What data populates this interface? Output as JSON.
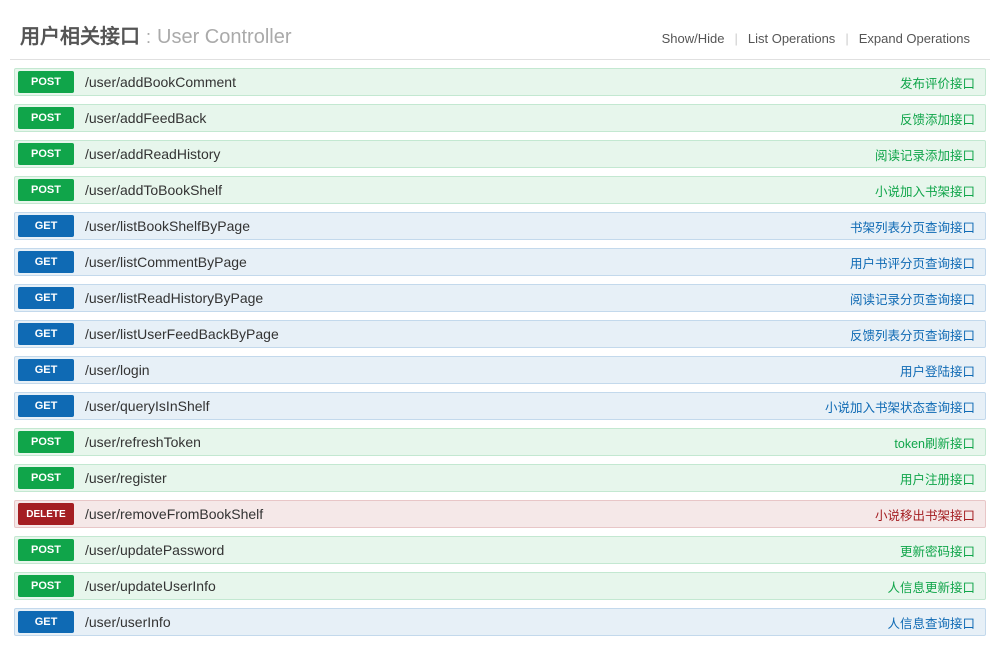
{
  "header": {
    "title_cn": "用户相关接口",
    "title_sep": ":",
    "title_en": "User Controller",
    "ops": {
      "showhide": "Show/Hide",
      "list": "List Operations",
      "expand": "Expand Operations"
    }
  },
  "endpoints": [
    {
      "method": "POST",
      "path": "/user/addBookComment",
      "desc": "发布评价接口"
    },
    {
      "method": "POST",
      "path": "/user/addFeedBack",
      "desc": "反馈添加接口"
    },
    {
      "method": "POST",
      "path": "/user/addReadHistory",
      "desc": "阅读记录添加接口"
    },
    {
      "method": "POST",
      "path": "/user/addToBookShelf",
      "desc": "小说加入书架接口"
    },
    {
      "method": "GET",
      "path": "/user/listBookShelfByPage",
      "desc": "书架列表分页查询接口"
    },
    {
      "method": "GET",
      "path": "/user/listCommentByPage",
      "desc": "用户书评分页查询接口"
    },
    {
      "method": "GET",
      "path": "/user/listReadHistoryByPage",
      "desc": "阅读记录分页查询接口"
    },
    {
      "method": "GET",
      "path": "/user/listUserFeedBackByPage",
      "desc": "反馈列表分页查询接口"
    },
    {
      "method": "GET",
      "path": "/user/login",
      "desc": "用户登陆接口"
    },
    {
      "method": "GET",
      "path": "/user/queryIsInShelf",
      "desc": "小说加入书架状态查询接口"
    },
    {
      "method": "POST",
      "path": "/user/refreshToken",
      "desc": "token刷新接口"
    },
    {
      "method": "POST",
      "path": "/user/register",
      "desc": "用户注册接口"
    },
    {
      "method": "DELETE",
      "path": "/user/removeFromBookShelf",
      "desc": "小说移出书架接口"
    },
    {
      "method": "POST",
      "path": "/user/updatePassword",
      "desc": "更新密码接口"
    },
    {
      "method": "POST",
      "path": "/user/updateUserInfo",
      "desc": "人信息更新接口"
    },
    {
      "method": "GET",
      "path": "/user/userInfo",
      "desc": "人信息查询接口"
    }
  ]
}
